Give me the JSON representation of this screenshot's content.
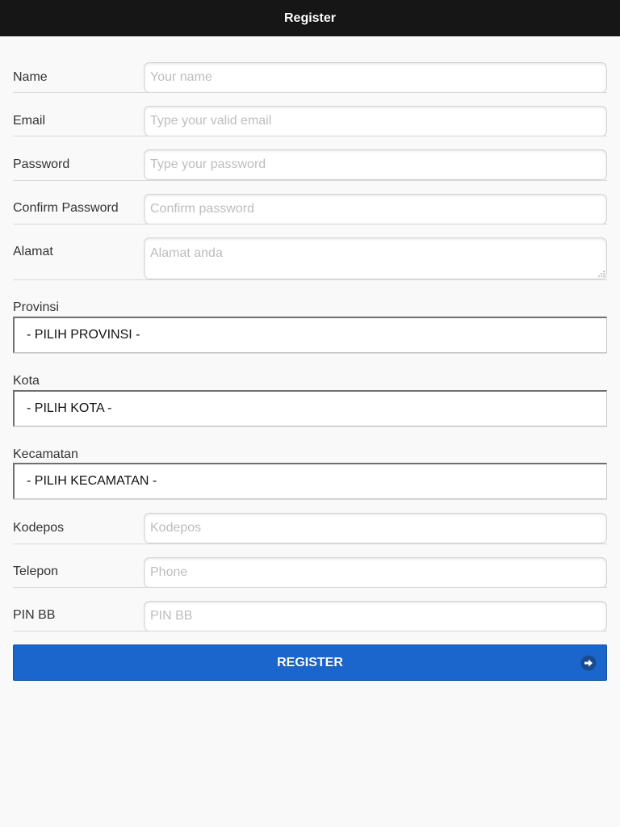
{
  "header": {
    "title": "Register"
  },
  "fields": {
    "name": {
      "label": "Name",
      "placeholder": "Your name"
    },
    "email": {
      "label": "Email",
      "placeholder": "Type your valid email"
    },
    "password": {
      "label": "Password",
      "placeholder": "Type your password"
    },
    "confirm": {
      "label": "Confirm Password",
      "placeholder": "Confirm password"
    },
    "alamat": {
      "label": "Alamat",
      "placeholder": "Alamat anda"
    },
    "kodepos": {
      "label": "Kodepos",
      "placeholder": "Kodepos"
    },
    "telepon": {
      "label": "Telepon",
      "placeholder": "Phone"
    },
    "pinbb": {
      "label": "PIN BB",
      "placeholder": "PIN BB"
    }
  },
  "selects": {
    "provinsi": {
      "label": "Provinsi",
      "value": "- PILIH PROVINSI -"
    },
    "kota": {
      "label": "Kota",
      "value": "- PILIH KOTA -"
    },
    "kecamatan": {
      "label": "Kecamatan",
      "value": "- PILIH KECAMATAN -"
    }
  },
  "register_button": {
    "label": "REGISTER",
    "icon": "arrow-right-icon"
  },
  "colors": {
    "header_bg": "#161616",
    "button_bg": "#1a66cc",
    "page_bg": "#f9f9f9"
  }
}
